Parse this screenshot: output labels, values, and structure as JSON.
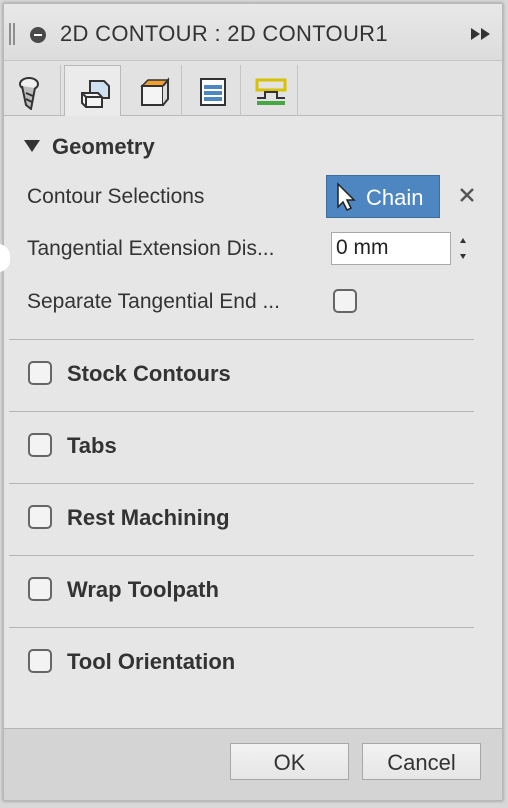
{
  "dialog": {
    "title": "2D CONTOUR : 2D CONTOUR1"
  },
  "tabs": [
    {
      "name": "tool",
      "icon": "tool-icon"
    },
    {
      "name": "geometry",
      "icon": "geometry-icon",
      "active": true
    },
    {
      "name": "heights",
      "icon": "heights-icon"
    },
    {
      "name": "passes",
      "icon": "passes-icon"
    },
    {
      "name": "linking",
      "icon": "linking-icon"
    }
  ],
  "geometry": {
    "header": "Geometry",
    "contour_selections_label": "Contour Selections",
    "chain_button_label": "Chain",
    "tangential_extension_label": "Tangential Extension Dis...",
    "tangential_extension_value": "0 mm",
    "separate_tangential_label": "Separate Tangential End ...",
    "separate_tangential_checked": false
  },
  "groups": [
    {
      "label": "Stock Contours",
      "checked": false
    },
    {
      "label": "Tabs",
      "checked": false
    },
    {
      "label": "Rest Machining",
      "checked": false
    },
    {
      "label": "Wrap Toolpath",
      "checked": false
    },
    {
      "label": "Tool Orientation",
      "checked": false
    }
  ],
  "footer": {
    "ok_label": "OK",
    "cancel_label": "Cancel"
  },
  "colors": {
    "accent": "#4d86c0",
    "panel": "#e6e6e6",
    "footer": "#d4d4d4"
  }
}
